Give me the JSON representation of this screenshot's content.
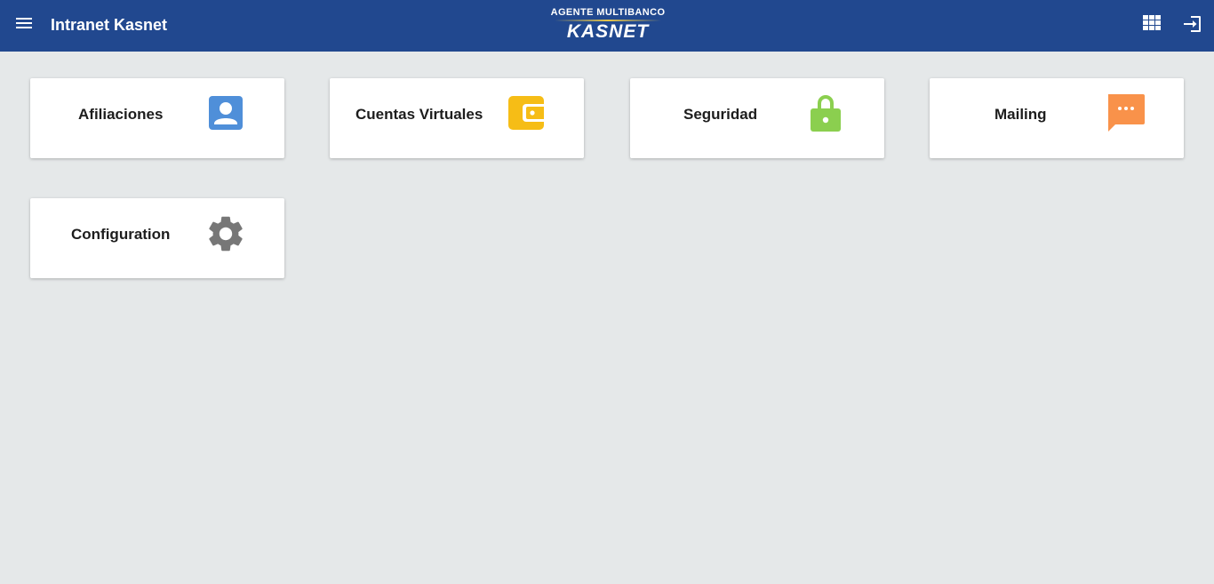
{
  "header": {
    "title": "Intranet Kasnet",
    "logo_top": "AGENTE MULTIBANCO",
    "logo_main": "KASNET",
    "menu_icon": "menu-icon",
    "apps_icon": "apps-grid-icon",
    "logout_icon": "logout-icon"
  },
  "modules": [
    {
      "label": "Afiliaciones",
      "icon": "contact-icon",
      "color": "#4f8fd9"
    },
    {
      "label": "Cuentas Virtuales",
      "icon": "wallet-icon",
      "color": "#f6bd16"
    },
    {
      "label": "Seguridad",
      "icon": "lock-icon",
      "color": "#8bcf4f"
    },
    {
      "label": "Mailing",
      "icon": "chat-icon",
      "color": "#f9924a"
    },
    {
      "label": "Configuration",
      "icon": "gear-icon",
      "color": "#777777"
    }
  ],
  "colors": {
    "header_bg": "#21488f",
    "page_bg": "#e5e8e9"
  }
}
